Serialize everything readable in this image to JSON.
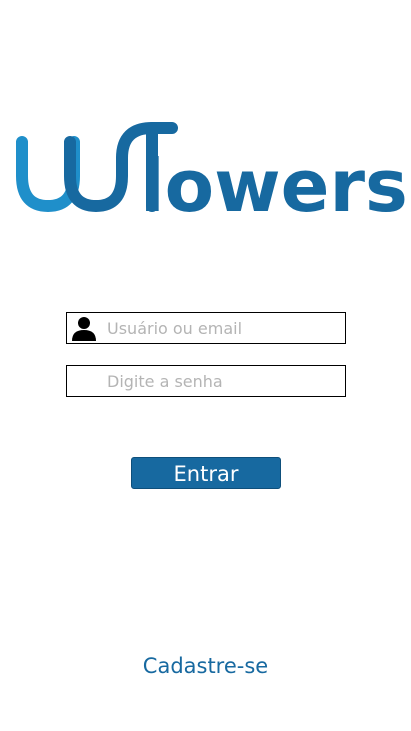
{
  "brand": {
    "wordmark": "lowers",
    "logo_icon": "w-wave-logo-icon",
    "colors": {
      "primary": "#1769a0",
      "light": "#1f8fca"
    }
  },
  "login_form": {
    "username": {
      "placeholder": "Usuário ou email",
      "value": "",
      "icon": "user-icon"
    },
    "password": {
      "placeholder": "Digite a senha",
      "value": ""
    },
    "submit_label": "Entrar"
  },
  "signup_link": "Cadastre-se"
}
